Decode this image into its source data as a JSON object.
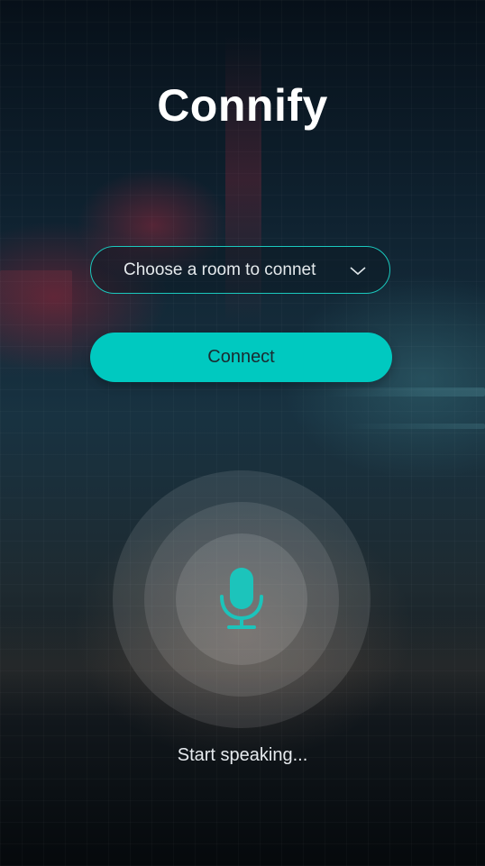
{
  "app": {
    "title": "Connify"
  },
  "room_select": {
    "placeholder": "Choose a room to connet",
    "icon": "chevron-down-icon"
  },
  "connect_button": {
    "label": "Connect"
  },
  "microphone": {
    "icon": "microphone-icon",
    "status": "Start speaking..."
  },
  "colors": {
    "accent": "#00C9C0",
    "text": "#FFFFFF"
  }
}
